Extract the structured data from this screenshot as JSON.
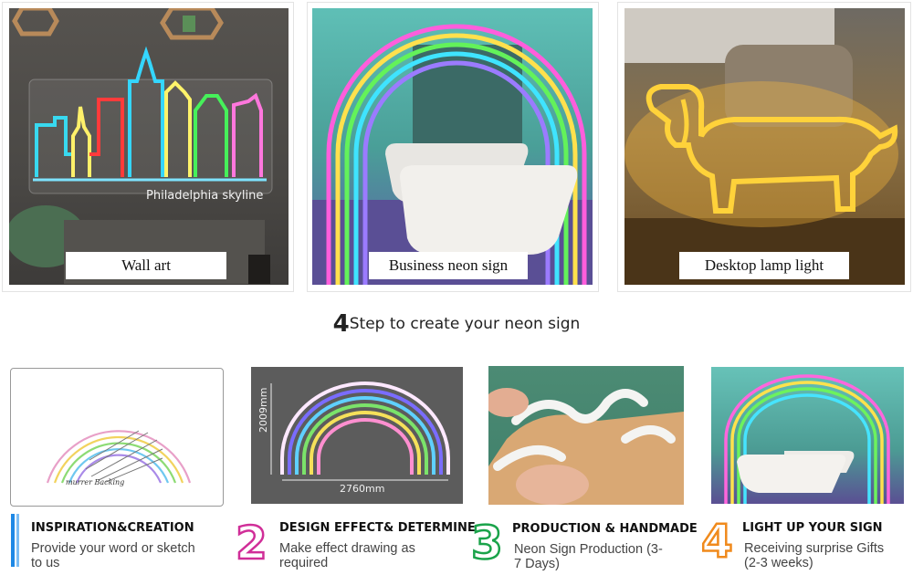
{
  "top_panels": [
    {
      "caption": "Wall art",
      "overlay": "Philadelphia skyline"
    },
    {
      "caption": "Business neon sign"
    },
    {
      "caption": "Desktop lamp light"
    }
  ],
  "section_heading": {
    "number": "4",
    "text": "Step to create your neon sign"
  },
  "sketch_note": "murrer Backing",
  "design_dims": {
    "height": "2009mm",
    "width": "2760mm"
  },
  "steps": [
    {
      "number": "1",
      "title": "INSPIRATION&CREATION",
      "description": "Provide your word or sketch to us",
      "color": "#1e88e5"
    },
    {
      "number": "2",
      "title": "DESIGN EFFECT& DETERMINE",
      "description": "Make effect drawing as required",
      "color": "#d02e98"
    },
    {
      "number": "3",
      "title": "PRODUCTION & HANDMADE",
      "description": "Neon Sign Production (3-7 Days)",
      "color": "#1aa34a"
    },
    {
      "number": "4",
      "title": "LIGHT UP YOUR SIGN",
      "description": "Receiving surprise Gifts (2-3 weeks)",
      "color": "#f08a1c"
    }
  ]
}
